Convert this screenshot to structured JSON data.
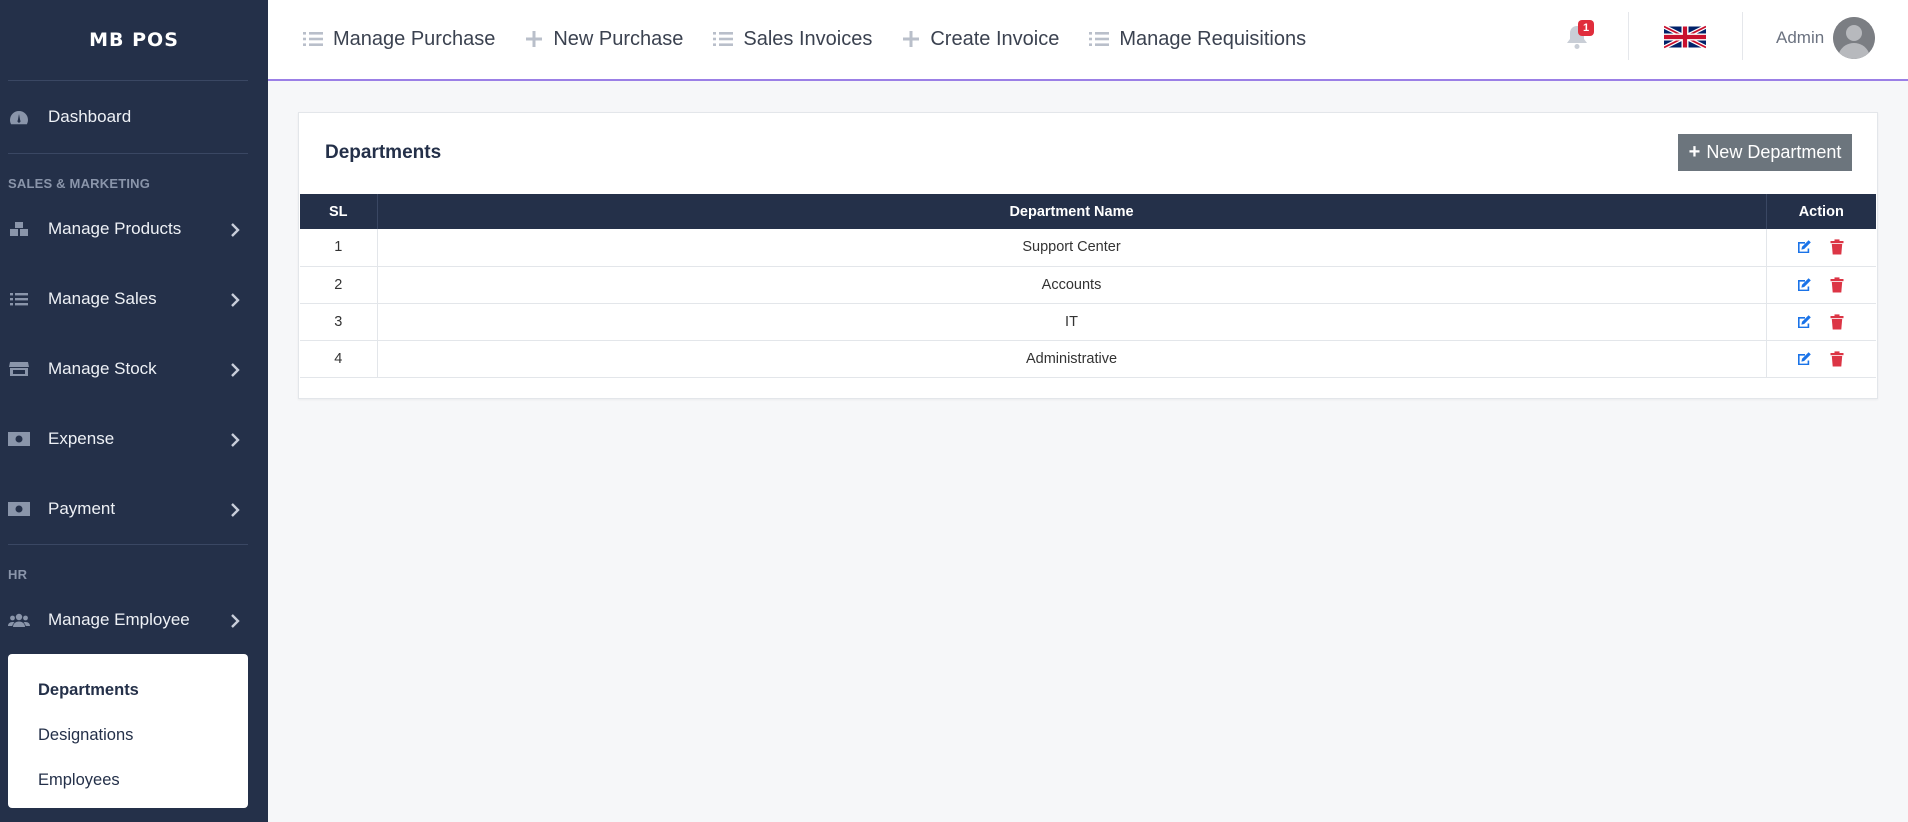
{
  "sidebar": {
    "brand": "MB POS",
    "dashboard": "Dashboard",
    "section_sales": "SALES & MARKETING",
    "items": [
      {
        "label": "Manage Products"
      },
      {
        "label": "Manage Sales"
      },
      {
        "label": "Manage Stock"
      },
      {
        "label": "Expense"
      },
      {
        "label": "Payment"
      }
    ],
    "section_hr": "HR",
    "employee": "Manage Employee",
    "submenu": [
      "Departments",
      "Designations",
      "Employees"
    ]
  },
  "topbar": {
    "nav": [
      "Manage Purchase",
      "New Purchase",
      "Sales Invoices",
      "Create Invoice",
      "Manage Requisitions"
    ],
    "notification_count": "1",
    "user": "Admin"
  },
  "main": {
    "title": "Departments",
    "new_button": "New Department",
    "columns": [
      "SL",
      "Department Name",
      "Action"
    ],
    "rows": [
      {
        "sl": "1",
        "name": "Support Center"
      },
      {
        "sl": "2",
        "name": "Accounts"
      },
      {
        "sl": "3",
        "name": "IT"
      },
      {
        "sl": "4",
        "name": "Administrative"
      }
    ]
  },
  "colors": {
    "sidebar_bg": "#243049",
    "accent_line": "#9b7fe6",
    "edit_icon": "#1a73e8",
    "delete_icon": "#dc3545",
    "badge": "#e02d3c"
  },
  "icons": {
    "dashboard": "gauge-icon",
    "products": "boxes-icon",
    "sales": "list-icon",
    "stock": "store-icon",
    "expense": "money-bill-icon",
    "payment": "money-bill-icon",
    "employee": "users-icon",
    "edit": "edit-icon",
    "delete": "trash-icon"
  }
}
